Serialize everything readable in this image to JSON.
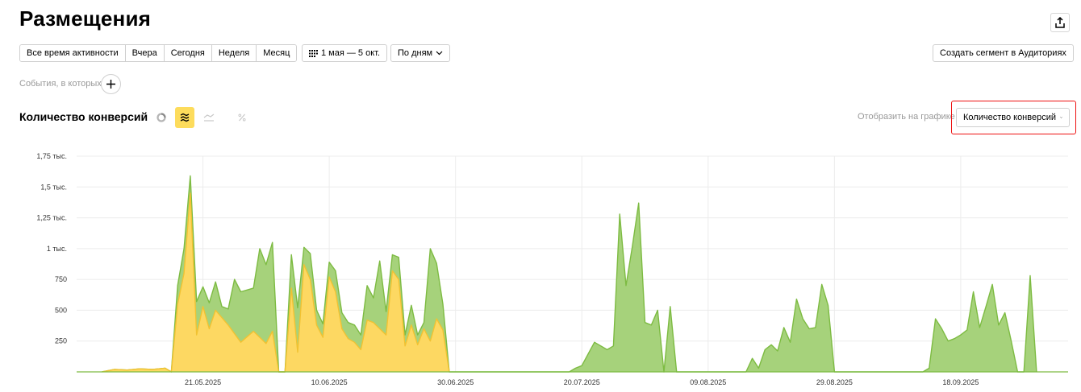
{
  "header": {
    "title": "Размещения",
    "export_icon": "share-upload-icon"
  },
  "period_tabs": [
    "Все время активности",
    "Вчера",
    "Сегодня",
    "Неделя",
    "Месяц"
  ],
  "date_range": {
    "label": "1 мая — 5 окт.",
    "icon": "calendar-grid-icon"
  },
  "grouping": {
    "label": "По дням"
  },
  "segment_button": {
    "label": "Создать сегмент в Аудиториях"
  },
  "events": {
    "label": "События, в которых"
  },
  "chart_header": {
    "title": "Количество конверсий",
    "tools": [
      "pie-chart-icon",
      "stacked-area-icon",
      "line-chart-icon",
      "percent-icon"
    ],
    "active_tool": "stacked-area-icon",
    "display_label": "Отобразить на графике",
    "display_value": "Количество конверсий"
  },
  "colors": {
    "green_fill": "#a6d27b",
    "green_line": "#7dbb42",
    "yellow_fill": "#fdd862",
    "yellow_line": "#f1c232",
    "highlight": "#e11111",
    "active_tool_bg": "#fddc5c"
  },
  "chart_data": {
    "type": "area",
    "stacked": true,
    "grid": true,
    "xlim": [
      "2025-05-01",
      "2025-10-05"
    ],
    "ylim": [
      0,
      1750
    ],
    "y_ticks": [
      250,
      500,
      750,
      1000,
      1250,
      1500,
      1750
    ],
    "y_tick_labels": [
      "250",
      "500",
      "750",
      "1 тыс.",
      "1,25 тыс.",
      "1,5 тыс.",
      "1,75 тыс."
    ],
    "x_tick_labels": [
      "21.05.2025",
      "10.06.2025",
      "30.06.2025",
      "20.07.2025",
      "09.08.2025",
      "29.08.2025",
      "18.09.2025"
    ],
    "series": [
      {
        "color": "#fdd862",
        "points": [
          [
            "2025-05-05",
            0
          ],
          [
            "2025-05-07",
            20
          ],
          [
            "2025-05-09",
            15
          ],
          [
            "2025-05-11",
            25
          ],
          [
            "2025-05-13",
            20
          ],
          [
            "2025-05-15",
            30
          ],
          [
            "2025-05-16",
            0
          ],
          [
            "2025-05-17",
            550
          ],
          [
            "2025-05-18",
            800
          ],
          [
            "2025-05-19",
            1450
          ],
          [
            "2025-05-20",
            300
          ],
          [
            "2025-05-21",
            530
          ],
          [
            "2025-05-22",
            350
          ],
          [
            "2025-05-23",
            500
          ],
          [
            "2025-05-25",
            380
          ],
          [
            "2025-05-27",
            240
          ],
          [
            "2025-05-29",
            330
          ],
          [
            "2025-05-31",
            230
          ],
          [
            "2025-06-01",
            330
          ],
          [
            "2025-06-02",
            0
          ],
          [
            "2025-06-03",
            0
          ],
          [
            "2025-06-04",
            680
          ],
          [
            "2025-06-05",
            160
          ],
          [
            "2025-06-06",
            870
          ],
          [
            "2025-06-07",
            750
          ],
          [
            "2025-06-08",
            380
          ],
          [
            "2025-06-09",
            280
          ],
          [
            "2025-06-10",
            770
          ],
          [
            "2025-06-11",
            650
          ],
          [
            "2025-06-12",
            350
          ],
          [
            "2025-06-13",
            270
          ],
          [
            "2025-06-14",
            240
          ],
          [
            "2025-06-15",
            180
          ],
          [
            "2025-06-16",
            420
          ],
          [
            "2025-06-17",
            400
          ],
          [
            "2025-06-18",
            350
          ],
          [
            "2025-06-19",
            300
          ],
          [
            "2025-06-20",
            820
          ],
          [
            "2025-06-21",
            750
          ],
          [
            "2025-06-22",
            210
          ],
          [
            "2025-06-23",
            380
          ],
          [
            "2025-06-24",
            220
          ],
          [
            "2025-06-25",
            350
          ],
          [
            "2025-06-26",
            250
          ],
          [
            "2025-06-27",
            430
          ],
          [
            "2025-06-28",
            340
          ],
          [
            "2025-06-29",
            0
          ]
        ]
      },
      {
        "color": "#a6d27b",
        "points": [
          [
            "2025-05-05",
            0
          ],
          [
            "2025-05-07",
            20
          ],
          [
            "2025-05-09",
            15
          ],
          [
            "2025-05-11",
            25
          ],
          [
            "2025-05-13",
            20
          ],
          [
            "2025-05-15",
            30
          ],
          [
            "2025-05-16",
            0
          ],
          [
            "2025-05-17",
            700
          ],
          [
            "2025-05-18",
            1000
          ],
          [
            "2025-05-19",
            1590
          ],
          [
            "2025-05-20",
            570
          ],
          [
            "2025-05-21",
            690
          ],
          [
            "2025-05-22",
            560
          ],
          [
            "2025-05-23",
            730
          ],
          [
            "2025-05-24",
            530
          ],
          [
            "2025-05-25",
            510
          ],
          [
            "2025-05-26",
            750
          ],
          [
            "2025-05-27",
            650
          ],
          [
            "2025-05-29",
            680
          ],
          [
            "2025-05-30",
            1000
          ],
          [
            "2025-05-31",
            870
          ],
          [
            "2025-06-01",
            1050
          ],
          [
            "2025-06-02",
            0
          ],
          [
            "2025-06-03",
            0
          ],
          [
            "2025-06-04",
            950
          ],
          [
            "2025-06-05",
            520
          ],
          [
            "2025-06-06",
            1010
          ],
          [
            "2025-06-07",
            960
          ],
          [
            "2025-06-08",
            500
          ],
          [
            "2025-06-09",
            390
          ],
          [
            "2025-06-10",
            890
          ],
          [
            "2025-06-11",
            820
          ],
          [
            "2025-06-12",
            480
          ],
          [
            "2025-06-13",
            400
          ],
          [
            "2025-06-14",
            380
          ],
          [
            "2025-06-15",
            300
          ],
          [
            "2025-06-16",
            700
          ],
          [
            "2025-06-17",
            600
          ],
          [
            "2025-06-18",
            900
          ],
          [
            "2025-06-19",
            490
          ],
          [
            "2025-06-20",
            950
          ],
          [
            "2025-06-21",
            930
          ],
          [
            "2025-06-22",
            300
          ],
          [
            "2025-06-23",
            540
          ],
          [
            "2025-06-24",
            300
          ],
          [
            "2025-06-25",
            400
          ],
          [
            "2025-06-26",
            1000
          ],
          [
            "2025-06-27",
            880
          ],
          [
            "2025-06-28",
            550
          ],
          [
            "2025-06-29",
            0
          ],
          [
            "2025-07-18",
            0
          ],
          [
            "2025-07-19",
            30
          ],
          [
            "2025-07-20",
            50
          ],
          [
            "2025-07-22",
            240
          ],
          [
            "2025-07-24",
            180
          ],
          [
            "2025-07-25",
            210
          ],
          [
            "2025-07-26",
            1280
          ],
          [
            "2025-07-27",
            700
          ],
          [
            "2025-07-28",
            1020
          ],
          [
            "2025-07-29",
            1370
          ],
          [
            "2025-07-30",
            400
          ],
          [
            "2025-07-31",
            380
          ],
          [
            "2025-08-01",
            500
          ],
          [
            "2025-08-02",
            0
          ],
          [
            "2025-08-03",
            530
          ],
          [
            "2025-08-04",
            0
          ],
          [
            "2025-08-15",
            0
          ],
          [
            "2025-08-16",
            110
          ],
          [
            "2025-08-17",
            30
          ],
          [
            "2025-08-18",
            180
          ],
          [
            "2025-08-19",
            220
          ],
          [
            "2025-08-20",
            170
          ],
          [
            "2025-08-21",
            360
          ],
          [
            "2025-08-22",
            240
          ],
          [
            "2025-08-23",
            590
          ],
          [
            "2025-08-24",
            430
          ],
          [
            "2025-08-25",
            350
          ],
          [
            "2025-08-26",
            360
          ],
          [
            "2025-08-27",
            710
          ],
          [
            "2025-08-28",
            540
          ],
          [
            "2025-08-29",
            0
          ],
          [
            "2025-09-12",
            0
          ],
          [
            "2025-09-13",
            30
          ],
          [
            "2025-09-14",
            430
          ],
          [
            "2025-09-15",
            350
          ],
          [
            "2025-09-16",
            250
          ],
          [
            "2025-09-17",
            270
          ],
          [
            "2025-09-18",
            300
          ],
          [
            "2025-09-19",
            340
          ],
          [
            "2025-09-20",
            650
          ],
          [
            "2025-09-21",
            360
          ],
          [
            "2025-09-22",
            530
          ],
          [
            "2025-09-23",
            710
          ],
          [
            "2025-09-24",
            380
          ],
          [
            "2025-09-25",
            480
          ],
          [
            "2025-09-26",
            250
          ],
          [
            "2025-09-27",
            0
          ],
          [
            "2025-09-28",
            0
          ],
          [
            "2025-09-29",
            780
          ],
          [
            "2025-09-30",
            0
          ]
        ]
      }
    ]
  }
}
